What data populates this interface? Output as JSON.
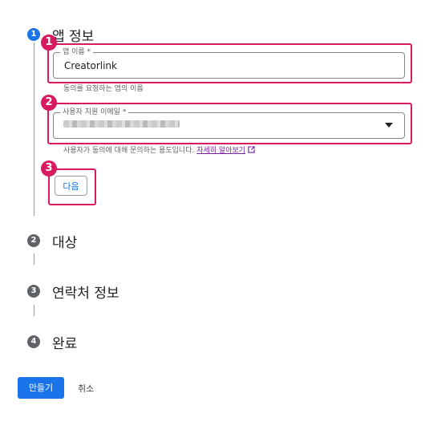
{
  "steps": [
    {
      "number": "1",
      "title": "앱 정보"
    },
    {
      "number": "2",
      "title": "대상"
    },
    {
      "number": "3",
      "title": "연락처 정보"
    },
    {
      "number": "4",
      "title": "완료"
    }
  ],
  "app_name_field": {
    "label": "앱 이름 *",
    "value": "Creatorlink",
    "helper": "동의를 요청하는 앱의 이름"
  },
  "support_email_field": {
    "label": "사용자 지원 이메일 *",
    "helper": "사용자가 동의에 대해 문의하는 용도입니다.",
    "link": "자세히 알아보기"
  },
  "next_button": "다음",
  "create_button": "만들기",
  "cancel_button": "취소",
  "badges": [
    "1",
    "2",
    "3"
  ],
  "colors": {
    "accent": "#1a73e8",
    "highlight": "#d81b60",
    "link": "#7b1fa2"
  }
}
